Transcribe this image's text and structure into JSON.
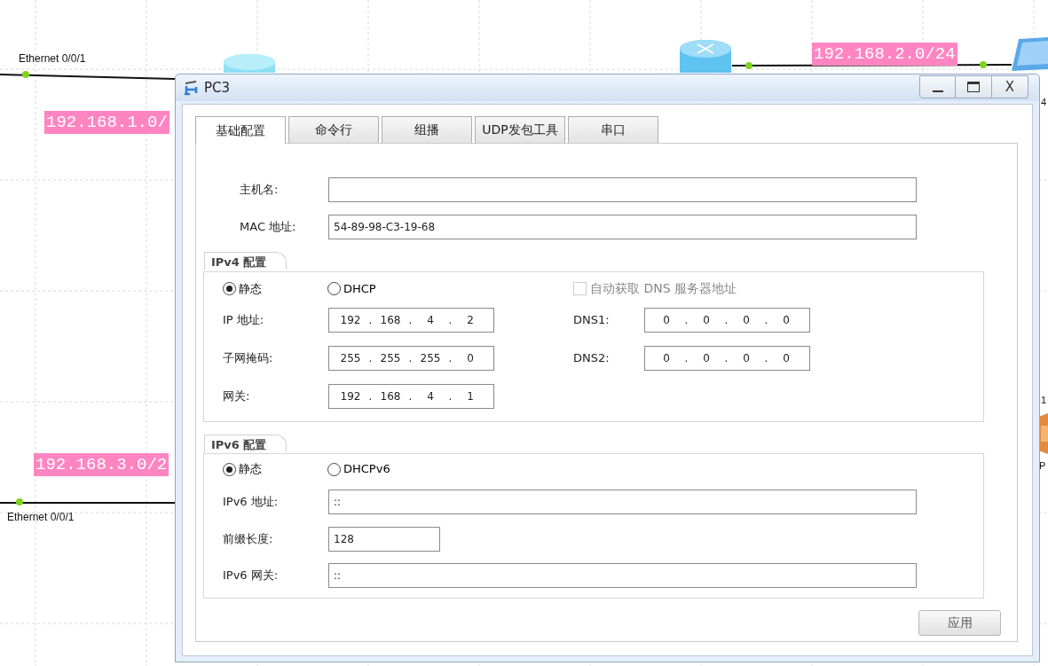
{
  "canvas": {
    "interface_labels": [
      "Ethernet 0/0/1",
      "Ethernet 0/0/1"
    ],
    "network_labels": [
      "192.168.1.0/",
      "192.168.2.0/24",
      "192.168.3.0/2"
    ],
    "device_labels": [
      "4",
      "1",
      "P"
    ]
  },
  "window": {
    "title": "PC3",
    "close": "X"
  },
  "tabs": [
    {
      "label": "基础配置",
      "selected": true
    },
    {
      "label": "命令行",
      "selected": false
    },
    {
      "label": "组播",
      "selected": false
    },
    {
      "label": "UDP发包工具",
      "selected": false
    },
    {
      "label": "串口",
      "selected": false
    }
  ],
  "host_fields": [
    {
      "label": "主机名:"
    },
    {
      "label": "MAC 地址:",
      "value": "54-89-98-C3-19-68"
    }
  ],
  "ipv4": {
    "title": "IPv4 配置",
    "modes": [
      {
        "label": "静态",
        "selected": true
      },
      {
        "label": "DHCP",
        "selected": false
      }
    ],
    "auto_dns": {
      "label": "自动获取 DNS 服务器地址",
      "checked": false,
      "disabled": true
    },
    "address_fields": [
      {
        "label": "IP 地址:",
        "value": "192 . 168 . 4 . 2"
      },
      {
        "label": "子网掩码:",
        "value": "255 . 255 . 255 . 0"
      },
      {
        "label": "网关:",
        "value": "192 . 168 . 4 . 1"
      }
    ],
    "dns_fields": [
      {
        "label": "DNS1:",
        "value": "0 . 0 . 0 . 0"
      },
      {
        "label": "DNS2:",
        "value": "0 . 0 . 0 . 0"
      }
    ]
  },
  "ipv6": {
    "title": "IPv6 配置",
    "modes": [
      {
        "label": "静态",
        "selected": true
      },
      {
        "label": "DHCPv6",
        "selected": false
      }
    ],
    "fields": [
      {
        "label": "IPv6 地址:",
        "value": "::",
        "kind": "wide"
      },
      {
        "label": "前缀长度:",
        "value": "128",
        "kind": "short"
      },
      {
        "label": "IPv6 网关:",
        "value": "::",
        "kind": "wide"
      }
    ]
  },
  "apply_button": {
    "label": "应用"
  }
}
